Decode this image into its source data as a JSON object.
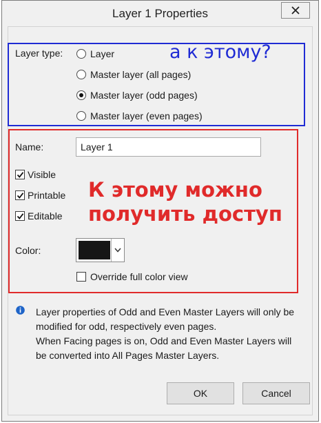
{
  "window": {
    "title": "Layer 1 Properties"
  },
  "layer_type": {
    "label": "Layer type:",
    "options": [
      {
        "label": "Layer",
        "selected": false
      },
      {
        "label": "Master layer (all pages)",
        "selected": false
      },
      {
        "label": "Master layer (odd pages)",
        "selected": true
      },
      {
        "label": "Master layer (even pages)",
        "selected": false
      }
    ]
  },
  "name": {
    "label": "Name:",
    "value": "Layer 1"
  },
  "flags": [
    {
      "label": "Visible",
      "checked": true
    },
    {
      "label": "Printable",
      "checked": true
    },
    {
      "label": "Editable",
      "checked": true
    }
  ],
  "color": {
    "label": "Color:",
    "value": "#161616"
  },
  "override": {
    "label": "Override full color view",
    "checked": false
  },
  "info": {
    "lines": [
      "Layer properties of Odd and Even Master Layers will only be",
      "modified for odd, respectively even pages.",
      "When Facing pages is on, Odd and Even Master Layers will",
      "be converted into All Pages Master Layers."
    ]
  },
  "buttons": {
    "ok": "OK",
    "cancel": "Cancel"
  },
  "annotations": {
    "blue_note": "а к этому?",
    "red_note_line1": "К этому можно",
    "red_note_line2": "получить доступ",
    "blue_color": "#1f2bd4",
    "red_color": "#e02a2a"
  }
}
